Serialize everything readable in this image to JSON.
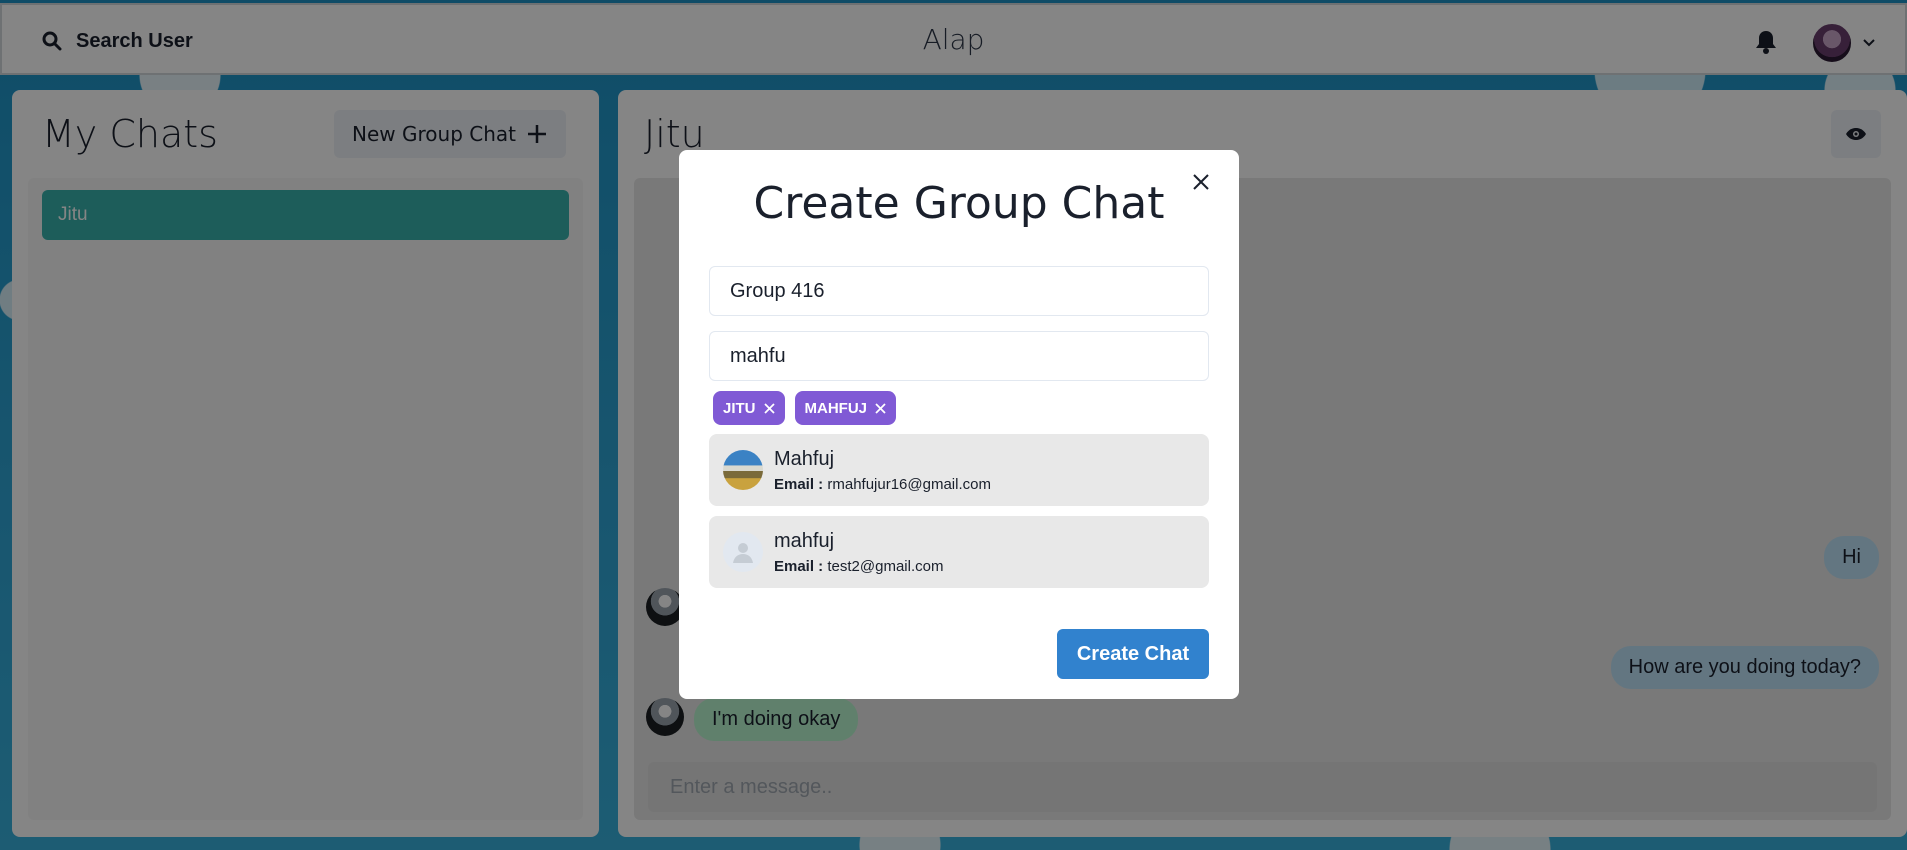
{
  "header": {
    "search_label": "Search User",
    "app_title": "Alap"
  },
  "sidebar": {
    "title": "My Chats",
    "new_group_label": "New Group Chat",
    "chats": [
      {
        "name": "Jitu",
        "selected": true
      }
    ]
  },
  "chat": {
    "name": "Jitu",
    "messages": [
      {
        "text": "Hi",
        "sender": "me"
      },
      {
        "text": "How are you doing today?",
        "sender": "me"
      },
      {
        "text": "I'm doing okay",
        "sender": "other"
      }
    ],
    "input_placeholder": "Enter a message.."
  },
  "modal": {
    "title": "Create Group Chat",
    "group_name_value": "Group 416",
    "search_value": "mahfu",
    "selected_users": [
      "JITU",
      "MAHFUJ"
    ],
    "results": [
      {
        "name": "Mahfuj",
        "email_label": "Email :",
        "email": "rmahfujur16@gmail.com",
        "avatar": "photo"
      },
      {
        "name": "mahfuj",
        "email_label": "Email :",
        "email": "test2@gmail.com",
        "avatar": "default-user-icon"
      }
    ],
    "create_label": "Create Chat"
  },
  "colors": {
    "accent_selected_chat": "#38b2ac",
    "chip": "#805ad5",
    "primary_button": "#3182ce",
    "my_message": "#bee3f8",
    "other_message": "#b9f5d0"
  }
}
